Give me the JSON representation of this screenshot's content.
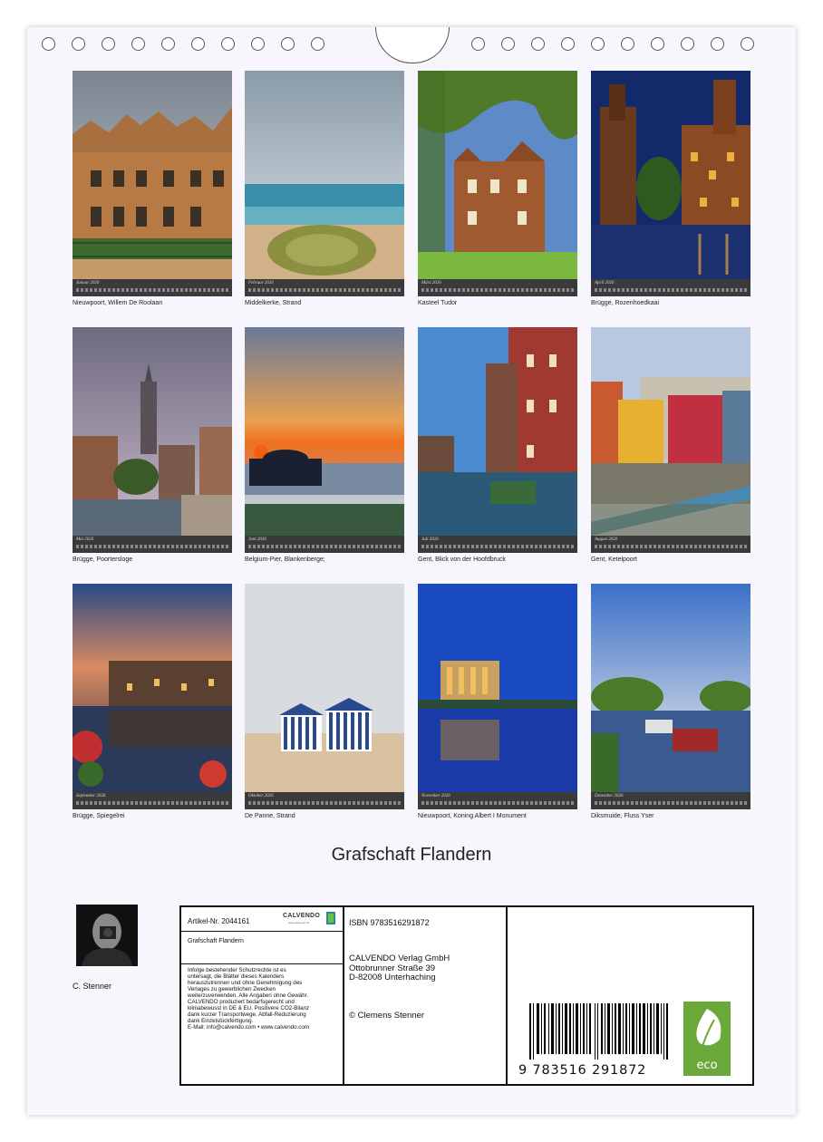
{
  "photos": [
    {
      "month": "Januar 2026",
      "caption": "Nieuwpoort, Willem De Roolaan"
    },
    {
      "month": "Februar 2026",
      "caption": "Middelkerke, Strand"
    },
    {
      "month": "März 2026",
      "caption": "Kasteel Tudor"
    },
    {
      "month": "April 2026",
      "caption": "Brügge, Rozenhoedkaai"
    },
    {
      "month": "Mai 2026",
      "caption": "Brügge, Poortersloge"
    },
    {
      "month": "Juni 2026",
      "caption": "Belgium-Pier, Blankenberge;"
    },
    {
      "month": "Juli 2026",
      "caption": "Gent, Blick von der Hoofdbruck"
    },
    {
      "month": "August 2026",
      "caption": "Gent, Ketelpoort"
    },
    {
      "month": "September 2026",
      "caption": "Brügge, Spiegelrei"
    },
    {
      "month": "Oktober 2026",
      "caption": "De Panne, Strand"
    },
    {
      "month": "November 2026",
      "caption": "Nieuwpoort, Koning Albert I Monument"
    },
    {
      "month": "Dezember 2026",
      "caption": "Diksmuide, Fluss Yser"
    }
  ],
  "title": "Grafschaft Flandern",
  "author": "C. Stenner",
  "info": {
    "article": "Artikel-Nr. 2044161",
    "brand": "CALVENDO",
    "brand_sub": "www.calvendo.de",
    "product_title": "Grafschaft Flandern",
    "legal": "Infolge bestehender Schutzrechte ist es\nuntersagt, die Blätter dieses Kalenders\nherauszutrennen und ohne Genehmigung des\nVerlages zu gewerblichen Zwecken\nweiterzuverwenden. Alle Angaben ohne Gewähr.\nCALVENDO produziert bedarfsgerecht und\nklimabewusst in DE & EU. Positivere CO2-Bilanz\ndank kurzer Transportwege. Abfall-Reduzierung\ndank Einzelstückfertigung.\nE-Mail: info@calvendo.com • www.calvendo.com",
    "isbn": "ISBN 9783516291872",
    "publisher": "CALVENDO Verlag GmbH\nOttobrunner Straße 39\nD-82008 Unterhaching",
    "copyright": "© Clemens Stenner",
    "barcode_number": "9 783516 291872",
    "eco_label": "eco"
  }
}
